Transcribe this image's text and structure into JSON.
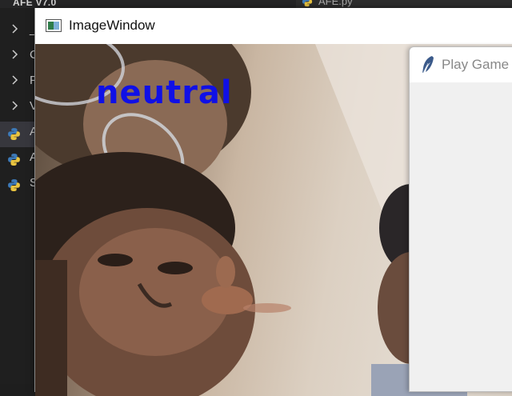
{
  "editor": {
    "explorer_title": "AFE V7.0",
    "tab_label": "AFE.py",
    "explorer_items": [
      {
        "label": "_",
        "kind": "folder"
      },
      {
        "label": "C",
        "kind": "folder"
      },
      {
        "label": "F",
        "kind": "folder"
      },
      {
        "label": "V",
        "kind": "folder"
      },
      {
        "label": "A",
        "kind": "python",
        "selected": true
      },
      {
        "label": "A",
        "kind": "python"
      },
      {
        "label": "S",
        "kind": "python"
      }
    ]
  },
  "image_window": {
    "title": "ImageWindow",
    "emotion_label": "neutral",
    "emotion_color": "#1010e6"
  },
  "game_window": {
    "title": "Play Game"
  }
}
